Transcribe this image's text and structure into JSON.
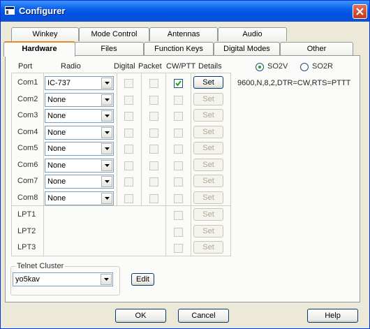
{
  "window": {
    "title": "Configurer"
  },
  "tabs_back": [
    "Winkey",
    "Mode Control",
    "Antennas",
    "Audio"
  ],
  "tabs_front": [
    "Hardware",
    "Files",
    "Function Keys",
    "Digital Modes",
    "Other"
  ],
  "headers": {
    "port": "Port",
    "radio": "Radio",
    "digital": "Digital",
    "packet": "Packet",
    "cwptt": "CW/PTT",
    "details": "Details"
  },
  "com_rows": [
    {
      "port": "Com1",
      "radio": "IC-737",
      "cwptt_checked": true,
      "set_enabled": true
    },
    {
      "port": "Com2",
      "radio": "None",
      "cwptt_checked": false,
      "set_enabled": false
    },
    {
      "port": "Com3",
      "radio": "None",
      "cwptt_checked": false,
      "set_enabled": false
    },
    {
      "port": "Com4",
      "radio": "None",
      "cwptt_checked": false,
      "set_enabled": false
    },
    {
      "port": "Com5",
      "radio": "None",
      "cwptt_checked": false,
      "set_enabled": false
    },
    {
      "port": "Com6",
      "radio": "None",
      "cwptt_checked": false,
      "set_enabled": false
    },
    {
      "port": "Com7",
      "radio": "None",
      "cwptt_checked": false,
      "set_enabled": false
    },
    {
      "port": "Com8",
      "radio": "None",
      "cwptt_checked": false,
      "set_enabled": false
    }
  ],
  "lpt_rows": [
    "LPT1",
    "LPT2",
    "LPT3"
  ],
  "set_label": "Set",
  "so": {
    "options": [
      "SO2V",
      "SO2R"
    ],
    "selected": "SO2V"
  },
  "com_settings": "9600,N,8,2,DTR=CW,RTS=PTTT",
  "telnet": {
    "group_label": "Telnet Cluster",
    "value": "yo5kav",
    "edit_label": "Edit"
  },
  "footer": {
    "ok": "OK",
    "cancel": "Cancel",
    "help": "Help"
  },
  "colors": {
    "title_bar": "#0054e3",
    "active_tab_accent": "#e68b2c",
    "face": "#ece9d8"
  }
}
